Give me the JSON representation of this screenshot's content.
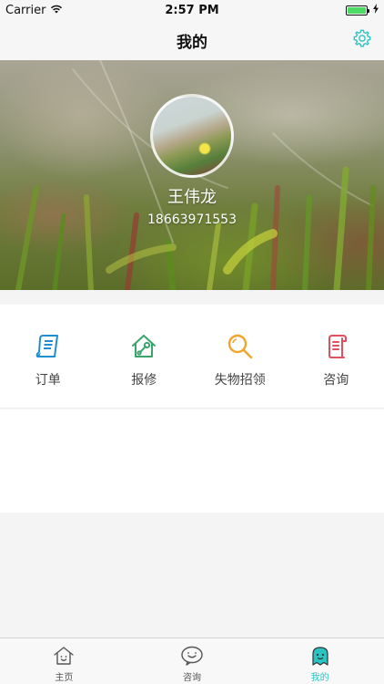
{
  "status_bar": {
    "carrier": "Carrier",
    "time": "2:57 PM",
    "battery_level": 1.0
  },
  "nav": {
    "title": "我的",
    "settings_icon": "gear-icon"
  },
  "profile": {
    "name": "王伟龙",
    "phone": "18663971553"
  },
  "functions": [
    {
      "label": "订单",
      "icon": "order-document-icon",
      "color": "#1f8fd0"
    },
    {
      "label": "报修",
      "icon": "house-wrench-icon",
      "color": "#3aa56b"
    },
    {
      "label": "失物招领",
      "icon": "magnifier-icon",
      "color": "#f0a52c"
    },
    {
      "label": "咨询",
      "icon": "scroll-icon",
      "color": "#e0515f"
    }
  ],
  "tabs": [
    {
      "label": "主页",
      "icon": "home-face-icon",
      "active": false
    },
    {
      "label": "咨询",
      "icon": "chat-face-icon",
      "active": false
    },
    {
      "label": "我的",
      "icon": "ghost-face-icon",
      "active": true
    }
  ],
  "colors": {
    "accent": "#2cc3c3"
  }
}
